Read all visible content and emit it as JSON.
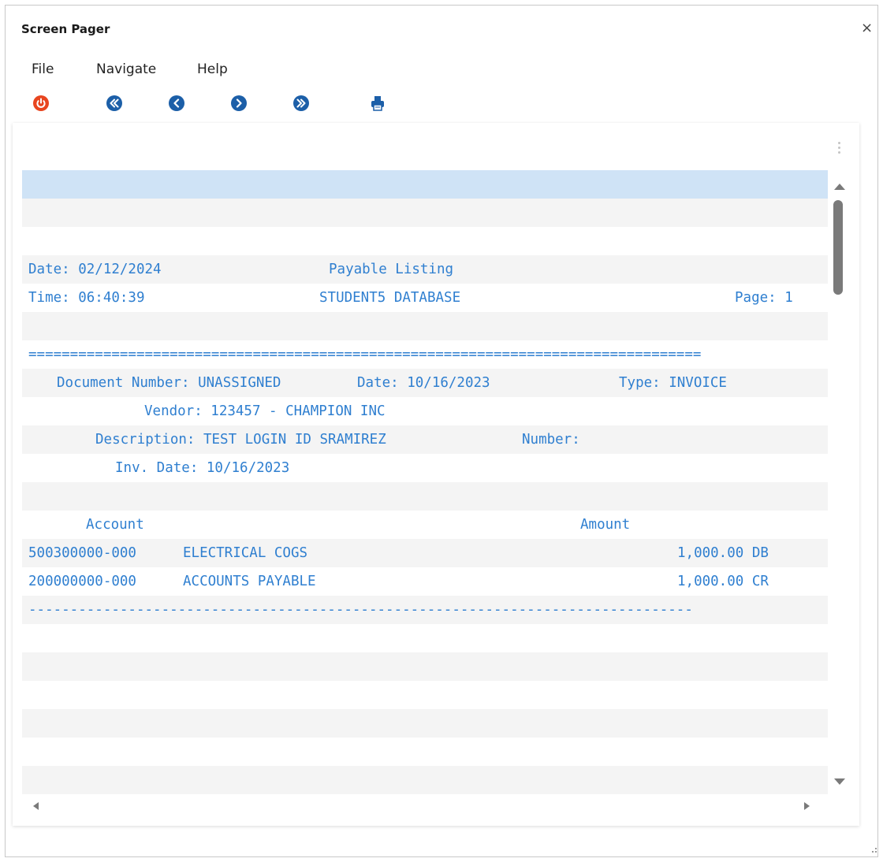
{
  "window": {
    "title": "Screen Pager",
    "close_glyph": "×"
  },
  "menu": [
    {
      "label": "File"
    },
    {
      "label": "Navigate"
    },
    {
      "label": "Help"
    }
  ],
  "toolbar": [
    {
      "icon": "power-icon",
      "color": "#e8451f"
    },
    {
      "icon": "first-page-icon",
      "color": "#1c5fa8"
    },
    {
      "icon": "previous-page-icon",
      "color": "#1c5fa8"
    },
    {
      "icon": "next-page-icon",
      "color": "#1c5fa8"
    },
    {
      "icon": "last-page-icon",
      "color": "#1c5fa8"
    },
    {
      "icon": "printer-icon",
      "color": "#1c5fa8"
    }
  ],
  "colors": {
    "report_text": "#2f7fd0",
    "selected_row": "#cfe3f6",
    "alt_row": "#f4f4f4"
  },
  "report": {
    "date_label": "Date: 02/12/2024",
    "title": "Payable Listing",
    "time_label": "Time: 06:40:39",
    "database": "STUDENT5 DATABASE",
    "page_label": "Page: 1",
    "double_rule": "=================================================================================",
    "document_number": "Document Number: UNASSIGNED",
    "document_date": "Date: 10/16/2023",
    "document_type": "Type: INVOICE",
    "vendor": "Vendor: 123457 - CHAMPION INC",
    "description": "Description: TEST LOGIN ID SRAMIREZ",
    "number_label": "Number:",
    "invoice_date": "Inv. Date: 10/16/2023",
    "account_header": "Account",
    "amount_header": "Amount",
    "entries": [
      {
        "account": "500300000-000",
        "name": "ELECTRICAL COGS",
        "amount": "1,000.00 DB"
      },
      {
        "account": "200000000-000",
        "name": "ACCOUNTS PAYABLE",
        "amount": "1,000.00 CR"
      }
    ],
    "single_rule": "--------------------------------------------------------------------------------"
  }
}
